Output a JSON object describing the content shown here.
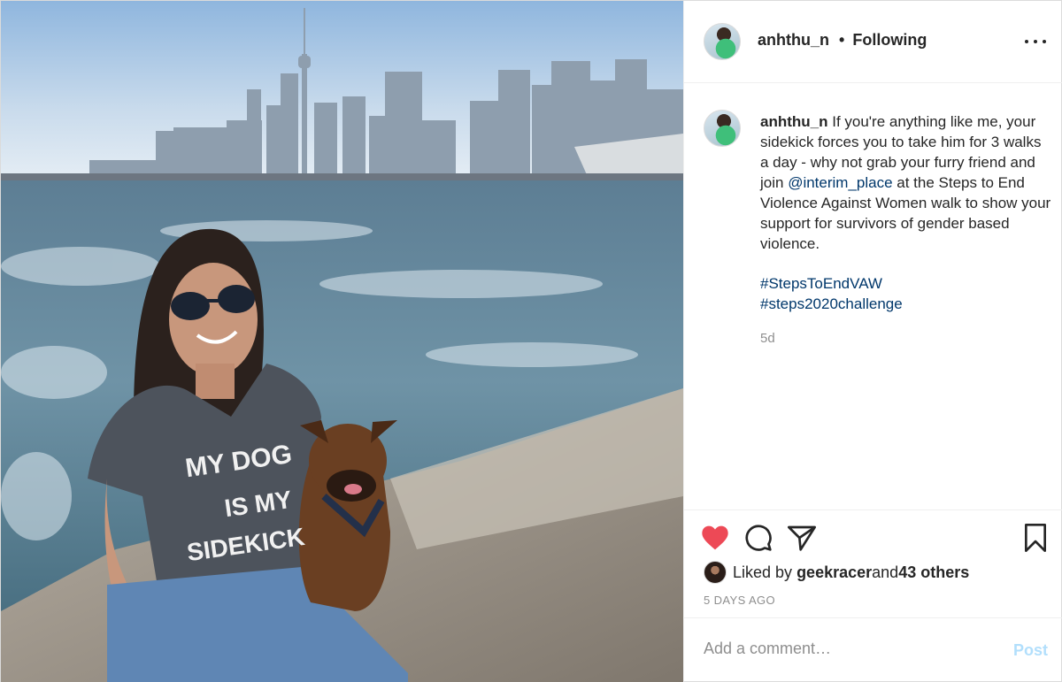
{
  "post": {
    "author": "anhthu_n",
    "separator": "•",
    "follow_status": "Following",
    "caption": {
      "username": "anhthu_n",
      "text_before_mention": " If you're anything like me, your sidekick forces you to take him for 3 walks a day - why not grab your furry friend and join ",
      "mention": "@interim_place",
      "text_after_mention": " at the Steps to End Violence Against Women walk to show your support for survivors of gender based violence.",
      "hashtags": [
        "#StepsToEndVAW",
        "#steps2020challenge"
      ],
      "age": "5d"
    },
    "photo": {
      "shirt_text": [
        "MY DOG",
        "IS MY",
        "SIDEKICK"
      ]
    },
    "likes": {
      "prefix": "Liked by ",
      "liked_by": "geekracer",
      "middle": " and ",
      "others": "43 others"
    },
    "timestamp": "5 DAYS AGO",
    "comment": {
      "placeholder": "Add a comment…",
      "post_label": "Post"
    },
    "colors": {
      "heart": "#ed4956",
      "link": "#00376b",
      "post_disabled": "#b2dffc",
      "muted": "#8e8e8e"
    },
    "icons": [
      "more-icon",
      "heart-icon",
      "comment-icon",
      "share-icon",
      "bookmark-icon"
    ]
  }
}
